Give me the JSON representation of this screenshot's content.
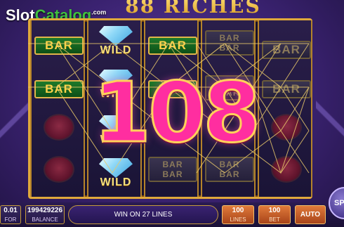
{
  "header": {
    "game_title": "88 RICHES",
    "watermark": {
      "part1": "Slot",
      "part2": "Catalog",
      "suffix": ".com"
    }
  },
  "symbols": {
    "bar": "BAR",
    "wild": "WILD"
  },
  "win_amount": "108",
  "bottom": {
    "bet_value": "0.01",
    "bet_label": "FOR",
    "balance_value": "199429226",
    "balance_label": "BALANCE",
    "win_message": "WIN ON 27 LINES",
    "lines_value": "100",
    "lines_label": "LINES",
    "bet_per_value": "100",
    "bet_per_label": "BET",
    "auto_label": "AUTO",
    "spin_label": "SP"
  },
  "colors": {
    "frame_gold": "#e0a93b",
    "win_pink": "#ff2ea0",
    "bar_green": "#1e7a2a",
    "background_purple": "#3a2270"
  }
}
